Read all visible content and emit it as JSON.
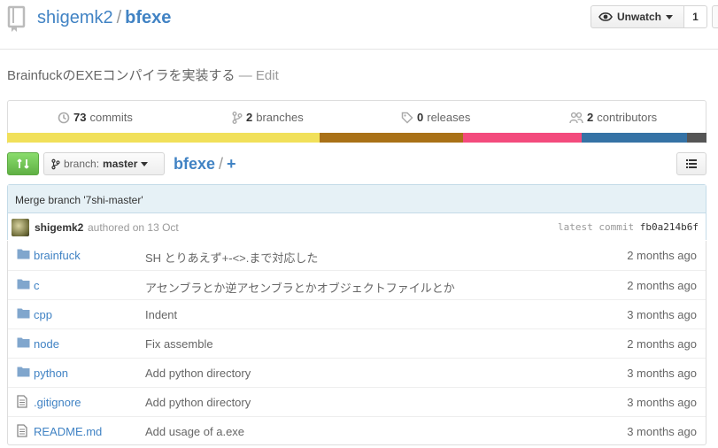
{
  "repo": {
    "owner": "shigemk2",
    "separator": "/",
    "name": "bfexe"
  },
  "watch": {
    "label": "Unwatch",
    "count": "1"
  },
  "description": {
    "text": "BrainfuckのEXEコンパイラを実装する",
    "edit_sep": "—",
    "edit_label": "Edit"
  },
  "stats": {
    "commits": {
      "count": "73",
      "label": "commits"
    },
    "branches": {
      "count": "2",
      "label": "branches"
    },
    "releases": {
      "count": "0",
      "label": "releases"
    },
    "contributors": {
      "count": "2",
      "label": "contributors"
    }
  },
  "language_colors": [
    "#f1e05a",
    "#a97117",
    "#f34b7d",
    "#3572a5",
    "#555555"
  ],
  "branch": {
    "label": "branch:",
    "value": "master"
  },
  "breadcrumb": {
    "root": "bfexe",
    "slash": "/",
    "add": "+"
  },
  "commit": {
    "message": "Merge branch '7shi-master'",
    "author": "shigemk2",
    "authored": "authored on 13 Oct",
    "latest_label": "latest commit",
    "sha": "fb0a214b6f"
  },
  "files": [
    {
      "icon": "folder-icon",
      "name": "brainfuck",
      "message": "SH とりあえず+-<>.まで対応した",
      "age": "2 months ago"
    },
    {
      "icon": "folder-icon",
      "name": "c",
      "message": "アセンブラとか逆アセンブラとかオブジェクトファイルとか",
      "age": "2 months ago"
    },
    {
      "icon": "folder-icon",
      "name": "cpp",
      "message": "Indent",
      "age": "3 months ago"
    },
    {
      "icon": "folder-icon",
      "name": "node",
      "message": "Fix assemble",
      "age": "2 months ago"
    },
    {
      "icon": "folder-icon",
      "name": "python",
      "message": "Add python directory",
      "age": "3 months ago"
    },
    {
      "icon": "file-icon",
      "name": ".gitignore",
      "message": "Add python directory",
      "age": "3 months ago"
    },
    {
      "icon": "file-icon",
      "name": "README.md",
      "message": "Add usage of a.exe",
      "age": "3 months ago"
    }
  ]
}
